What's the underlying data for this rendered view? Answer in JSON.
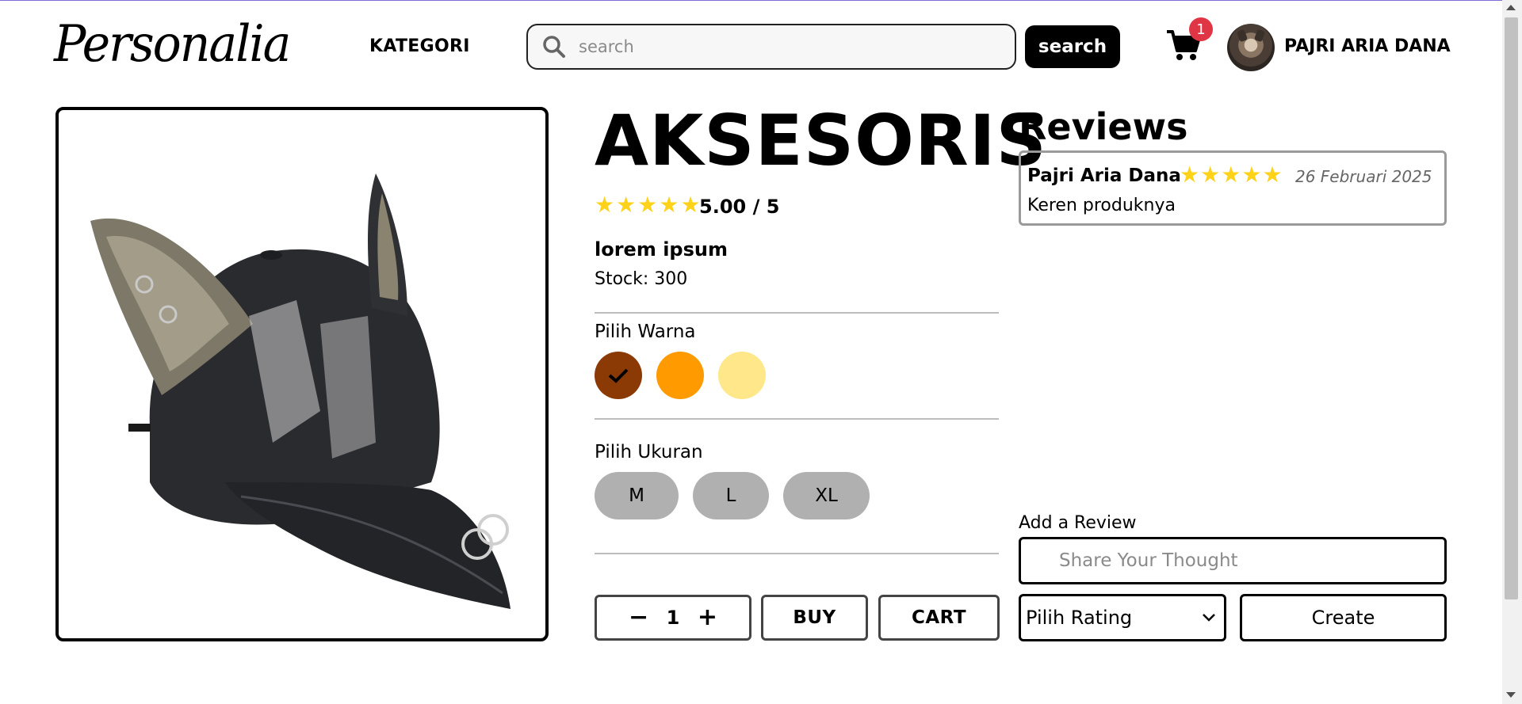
{
  "header": {
    "logo": "Personalia",
    "kategori": "KATEGORI",
    "search_placeholder": "search",
    "search_button": "search",
    "cart_count": "1",
    "username": "PAJRI ARIA DANA"
  },
  "product": {
    "image_icon": "denim-cap-with-ears-image",
    "title": "AKSESORIS",
    "rating": 5,
    "rating_text": "5.00 / 5",
    "name": "lorem ipsum",
    "stock": "Stock: 300",
    "color_label": "Pilih Warna",
    "colors": [
      {
        "hex": "#8b3a06",
        "selected": true
      },
      {
        "hex": "#ff9a00",
        "selected": false
      },
      {
        "hex": "#ffe78a",
        "selected": false
      }
    ],
    "size_label": "Pilih Ukuran",
    "sizes": [
      "M",
      "L",
      "XL"
    ],
    "quantity": "1",
    "buy_label": "BUY",
    "cart_label": "CART"
  },
  "reviews": {
    "title": "Reviews",
    "items": [
      {
        "name": "Pajri Aria Dana",
        "stars": 5,
        "date": "26 Februari 2025",
        "text": "Keren produknya"
      }
    ],
    "add_label": "Add a Review",
    "input_placeholder": "Share Your Thought",
    "rating_select": "Pilih Rating",
    "create_label": "Create"
  },
  "colors": {
    "star": "#ffd21a",
    "badge": "#e03545",
    "size_bg": "#b0b0b0"
  }
}
